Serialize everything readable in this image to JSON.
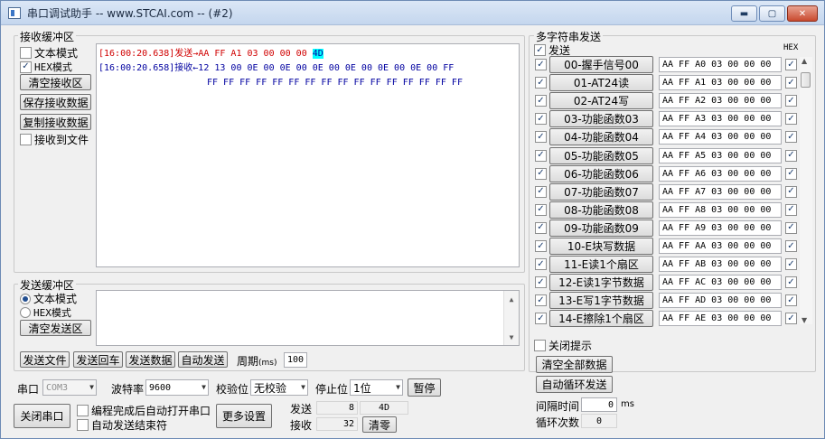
{
  "window": {
    "title": "串口调试助手 -- www.STCAI.com -- (#2)"
  },
  "receive": {
    "group_label": "接收缓冲区",
    "text_mode": "文本模式",
    "hex_mode": "HEX模式",
    "clear_btn": "清空接收区",
    "save_btn": "保存接收数据",
    "copy_btn": "复制接收数据",
    "to_file": "接收到文件",
    "line1_prefix": "[16:00:20.638]发送→",
    "line1_data": "AA FF A1 03 00 00 00 ",
    "line1_hl": "4D",
    "line2": "[16:00:20.658]接收←12 13 00 0E 00 0E 00 0E 00 0E 00 0E 00 0E 00 FF",
    "line3": "FF FF FF FF FF FF FF FF FF FF FF FF FF FF FF FF"
  },
  "send": {
    "group_label": "发送缓冲区",
    "text_mode": "文本模式",
    "hex_mode": "HEX模式",
    "clear_btn": "清空发送区",
    "send_file": "发送文件",
    "send_enter": "发送回车",
    "send_data": "发送数据",
    "auto_send": "自动发送",
    "period_label": "周期",
    "period_unit": "(ms)",
    "period_value": "100"
  },
  "port": {
    "port_label": "串口",
    "port_value": "COM3",
    "baud_label": "波特率",
    "baud_value": "9600",
    "parity_label": "校验位",
    "parity_value": "无校验",
    "stop_label": "停止位",
    "stop_value": "1位",
    "pause_btn": "暂停",
    "close_btn": "关闭串口",
    "auto_open": "编程完成后自动打开串口",
    "auto_end": "自动发送结束符",
    "more_btn": "更多设置",
    "tx_label": "发送",
    "tx_count": "8",
    "tx_last": "4D",
    "rx_label": "接收",
    "rx_count": "32",
    "clear_count_btn": "清零"
  },
  "multi": {
    "group_label": "多字符串发送",
    "send_header": "发送",
    "hex_header": "HEX",
    "rows": [
      {
        "label": "00-握手信号00",
        "data": "AA FF A0 03 00 00 00"
      },
      {
        "label": "01-AT24读",
        "data": "AA FF A1 03 00 00 00"
      },
      {
        "label": "02-AT24写",
        "data": "AA FF A2 03 00 00 00"
      },
      {
        "label": "03-功能函数03",
        "data": "AA FF A3 03 00 00 00"
      },
      {
        "label": "04-功能函数04",
        "data": "AA FF A4 03 00 00 00"
      },
      {
        "label": "05-功能函数05",
        "data": "AA FF A5 03 00 00 00"
      },
      {
        "label": "06-功能函数06",
        "data": "AA FF A6 03 00 00 00"
      },
      {
        "label": "07-功能函数07",
        "data": "AA FF A7 03 00 00 00"
      },
      {
        "label": "08-功能函数08",
        "data": "AA FF A8 03 00 00 00"
      },
      {
        "label": "09-功能函数09",
        "data": "AA FF A9 03 00 00 00"
      },
      {
        "label": "10-E块写数据",
        "data": "AA FF AA 03 00 00 00"
      },
      {
        "label": "11-E读1个扇区",
        "data": "AA FF AB 03 00 00 00"
      },
      {
        "label": "12-E读1字节数据",
        "data": "AA FF AC 03 00 00 00"
      },
      {
        "label": "13-E写1字节数据",
        "data": "AA FF AD 03 00 00 00"
      },
      {
        "label": "14-E擦除1个扇区",
        "data": "AA FF AE 03 00 00 00"
      }
    ],
    "close_hint": "关闭提示",
    "clear_all_btn": "清空全部数据",
    "auto_loop_btn": "自动循环发送",
    "interval_label": "间隔时间",
    "interval_value": "0",
    "interval_unit": "ms",
    "loop_label": "循环次数",
    "loop_value": "0"
  }
}
